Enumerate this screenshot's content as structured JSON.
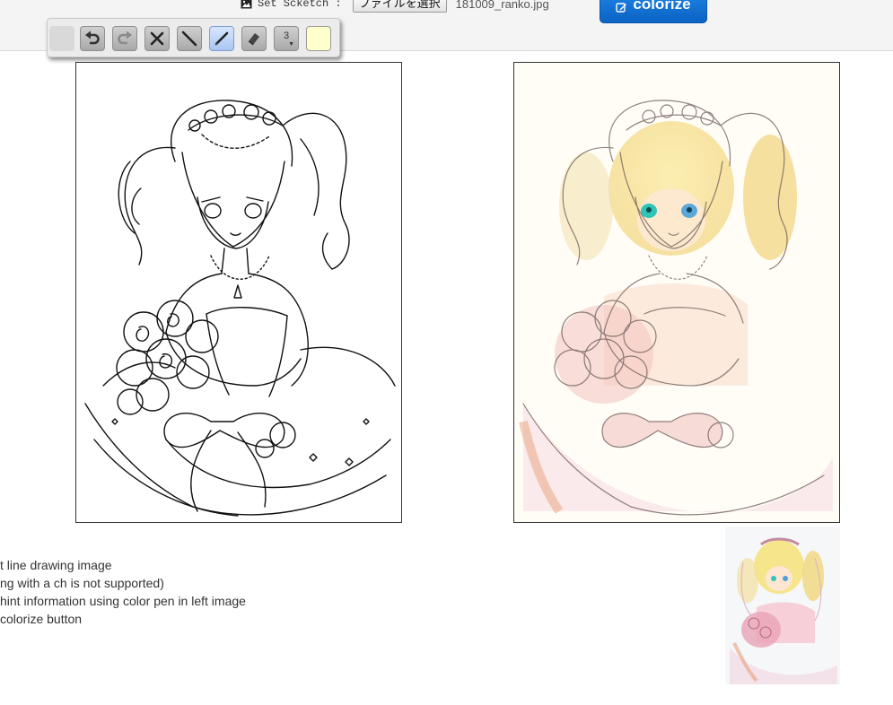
{
  "header": {
    "sketch_label": "Set Scketch :",
    "file_button_label": "ファイルを選択",
    "file_name": "181009_ranko.jpg",
    "colorize_label": "colorize",
    "accent_color": "#0b62c4"
  },
  "toolbar": {
    "tools": [
      {
        "name": "handle",
        "icon": "grip"
      },
      {
        "name": "undo",
        "icon": "undo-icon"
      },
      {
        "name": "redo",
        "icon": "redo-icon"
      },
      {
        "name": "clear",
        "icon": "close-icon"
      },
      {
        "name": "line",
        "icon": "line-icon"
      },
      {
        "name": "pen",
        "icon": "pen-icon",
        "active": true
      },
      {
        "name": "eraser",
        "icon": "eraser-icon"
      },
      {
        "name": "pen-size",
        "icon": "size-select",
        "value": "3"
      },
      {
        "name": "color",
        "icon": "color-swatch",
        "color": "#ffffcc"
      }
    ]
  },
  "instructions": [
    "t line drawing image",
    "ng with a ch is not supported)",
    "hint information using color pen in left image",
    " colorize button"
  ]
}
